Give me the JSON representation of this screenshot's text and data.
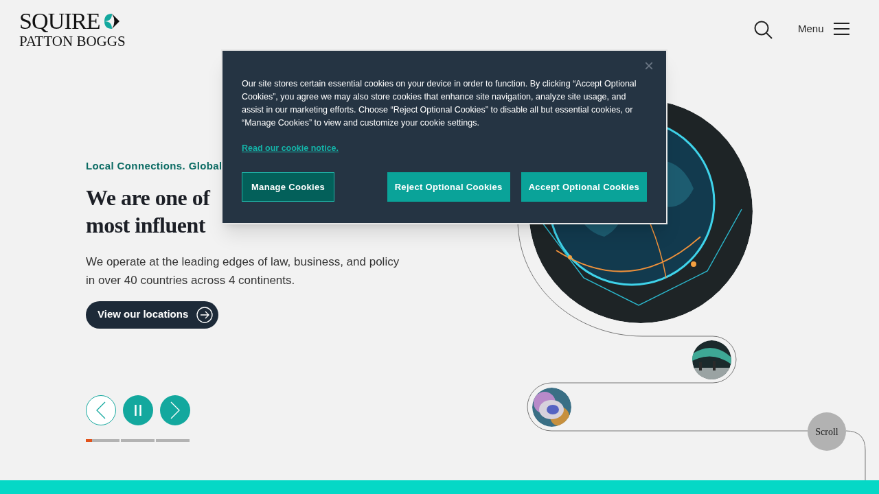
{
  "header": {
    "logo": {
      "line_1": "SQUIRE",
      "line_2": "PATTON BOGGS"
    },
    "menu_label": "Menu"
  },
  "hero": {
    "eyebrow": "Local Connections. Global",
    "heading_lines": [
      "We are one of",
      "most influent"
    ],
    "body_lines": [
      "We operate at the leading edges of law, business, and policy",
      "in over 40 countries across 4 continents."
    ],
    "cta": "View our locations",
    "slide_indicators": [
      {
        "selected": true
      },
      {
        "selected": false
      },
      {
        "selected": false
      }
    ],
    "slide_progress": {
      "level": 0.18
    },
    "paused": false
  },
  "scroll_label": "Scroll",
  "cookie_dialog": {
    "close": "×",
    "message": "Our site stores certain essential cookies on your device in order to function. By clicking “Accept Optional Cookies”, you agree we may also store cookies that enhance site navigation, analyze site usage, and assist in our marketing efforts. Choose “Reject Optional Cookies” to disable all but essential cookies, or “Manage Cookies” to view and customize your cookie settings.",
    "link": "Read our cookie notice.",
    "buttons": [
      {
        "label": "Manage Cookies",
        "kind": "secondary"
      },
      {
        "label": "Reject Optional Cookies",
        "kind": "primary"
      },
      {
        "label": "Accept Optional Cookies",
        "kind": "primary"
      }
    ]
  }
}
